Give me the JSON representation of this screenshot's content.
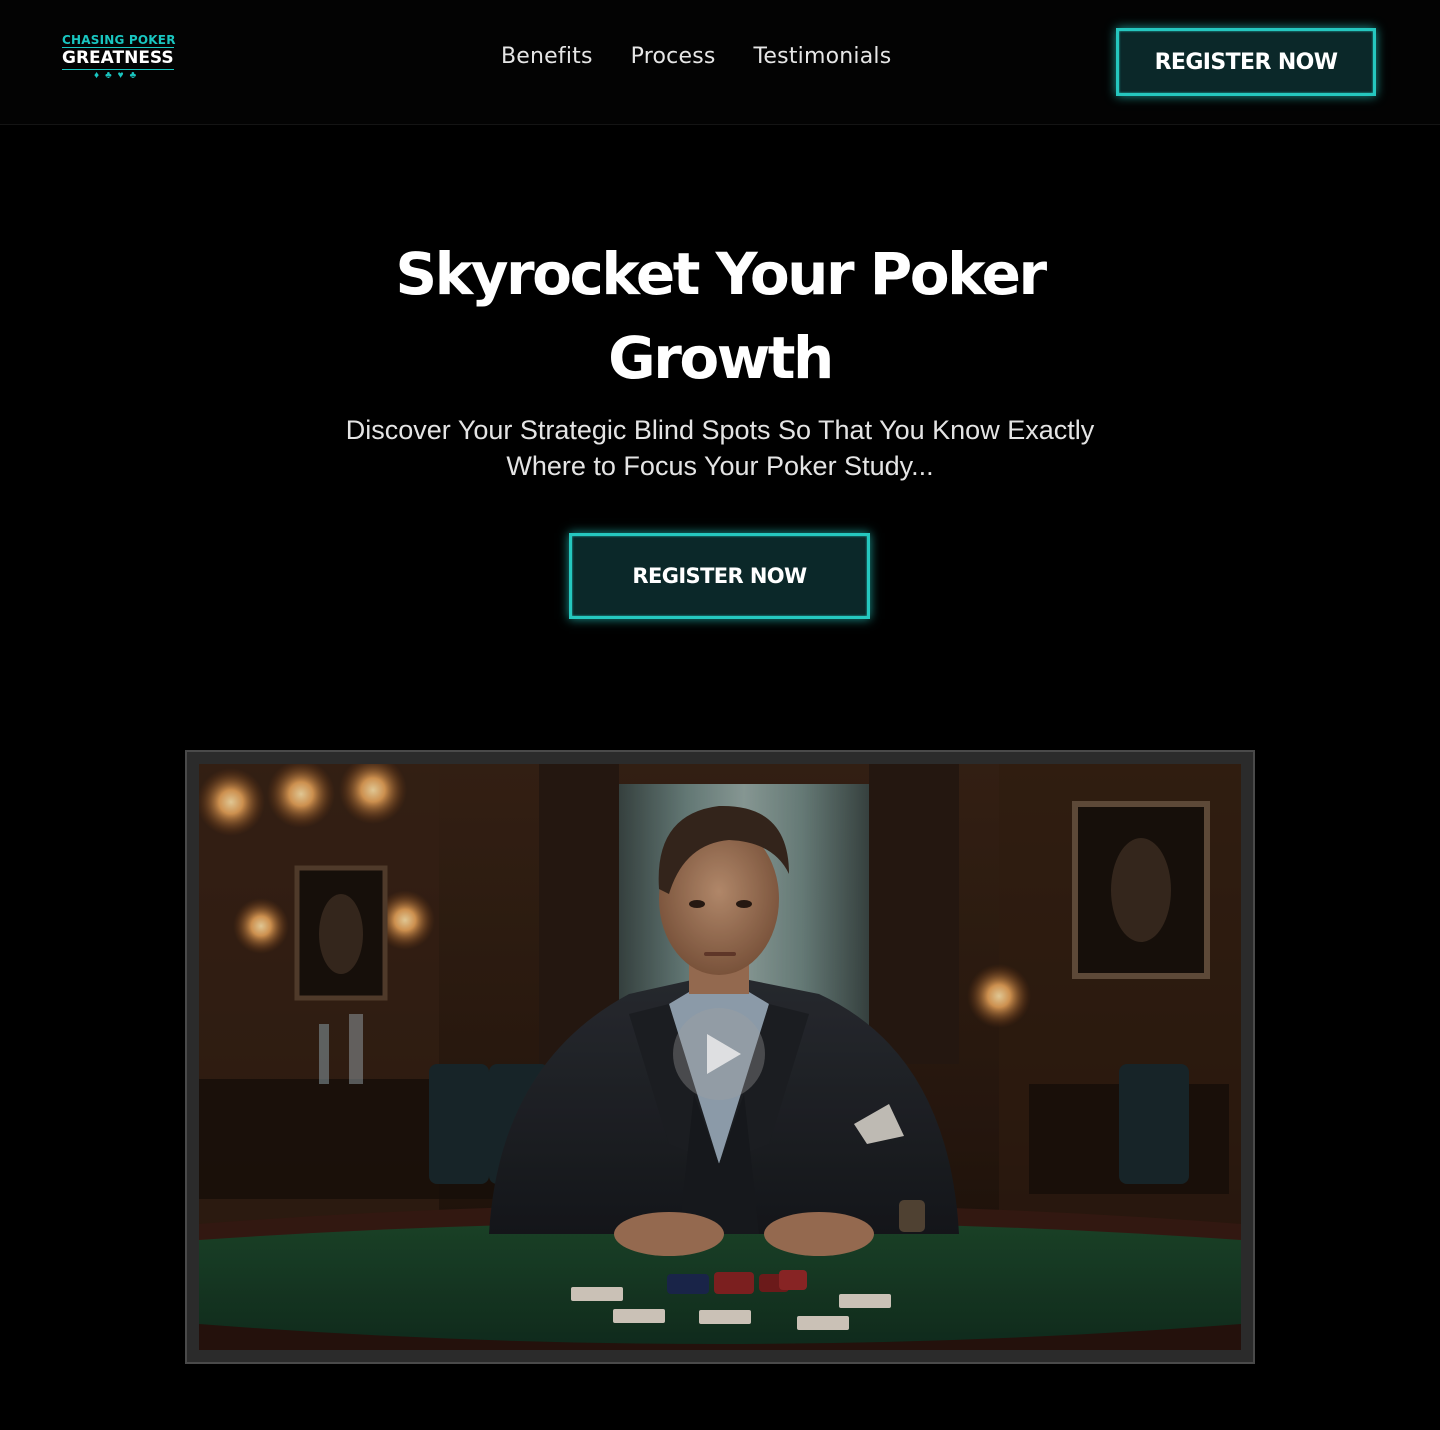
{
  "header": {
    "logo": {
      "top_text": "CHASING POKER",
      "main_text": "GREATNESS",
      "suits": "♦♣♥♣"
    },
    "nav": [
      {
        "label": "Benefits"
      },
      {
        "label": "Process"
      },
      {
        "label": "Testimonials"
      }
    ],
    "register_label": "REGISTER NOW"
  },
  "hero": {
    "title_line1": "Skyrocket Your Poker",
    "title_line2": "Growth",
    "subtitle_line1": "Discover Your Strategic Blind Spots So That You Know Exactly",
    "subtitle_line2": "Where to Focus Your Poker Study...",
    "register_label": "REGISTER NOW"
  },
  "video": {
    "play_icon": "play-icon"
  },
  "colors": {
    "accent": "#25c7bf",
    "button_bg": "#0b2829",
    "background": "#000000"
  }
}
